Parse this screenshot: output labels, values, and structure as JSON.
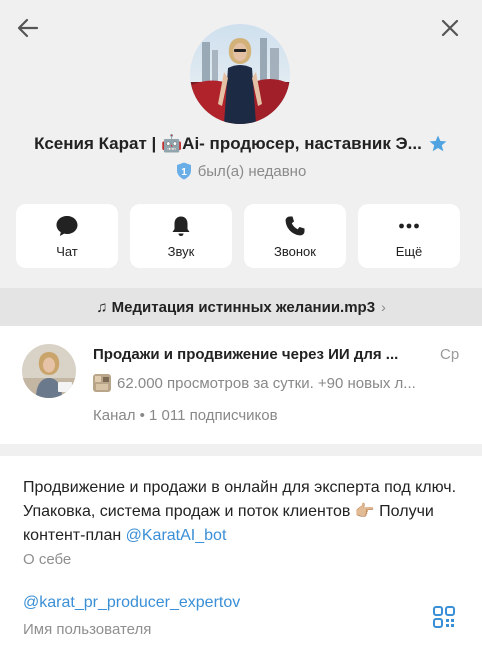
{
  "header": {
    "name": "Ксения Карат | 🤖Ai- продюсер, наставник Э...",
    "status": "был(а) недавно",
    "premium_icon": "star-icon",
    "accent": "#3a8fd6"
  },
  "actions": [
    {
      "label": "Чат",
      "icon": "chat-icon"
    },
    {
      "label": "Звук",
      "icon": "bell-icon"
    },
    {
      "label": "Звонок",
      "icon": "phone-icon"
    },
    {
      "label": "Ещё",
      "icon": "more-icon"
    }
  ],
  "music": {
    "title": "♫ Медитация истинных желании.mp3",
    "chevron": "›"
  },
  "channel": {
    "title": "Продажи и продвижение через ИИ для ...",
    "date": "Ср",
    "preview": "62.000 просмотров за сутки. +90 новых л...",
    "meta": "Канал • 1 011 подписчиков"
  },
  "bio": {
    "text": "Продвижение и продажи в онлайн для эксперта под ключ. Упаковка, система продаж и поток клиентов 👉🏼 Получи контент-план ",
    "link": "@KaratAI_bot",
    "label": "О себе"
  },
  "username": {
    "value": "@karat_pr_producer_expertov",
    "label": "Имя пользователя"
  }
}
